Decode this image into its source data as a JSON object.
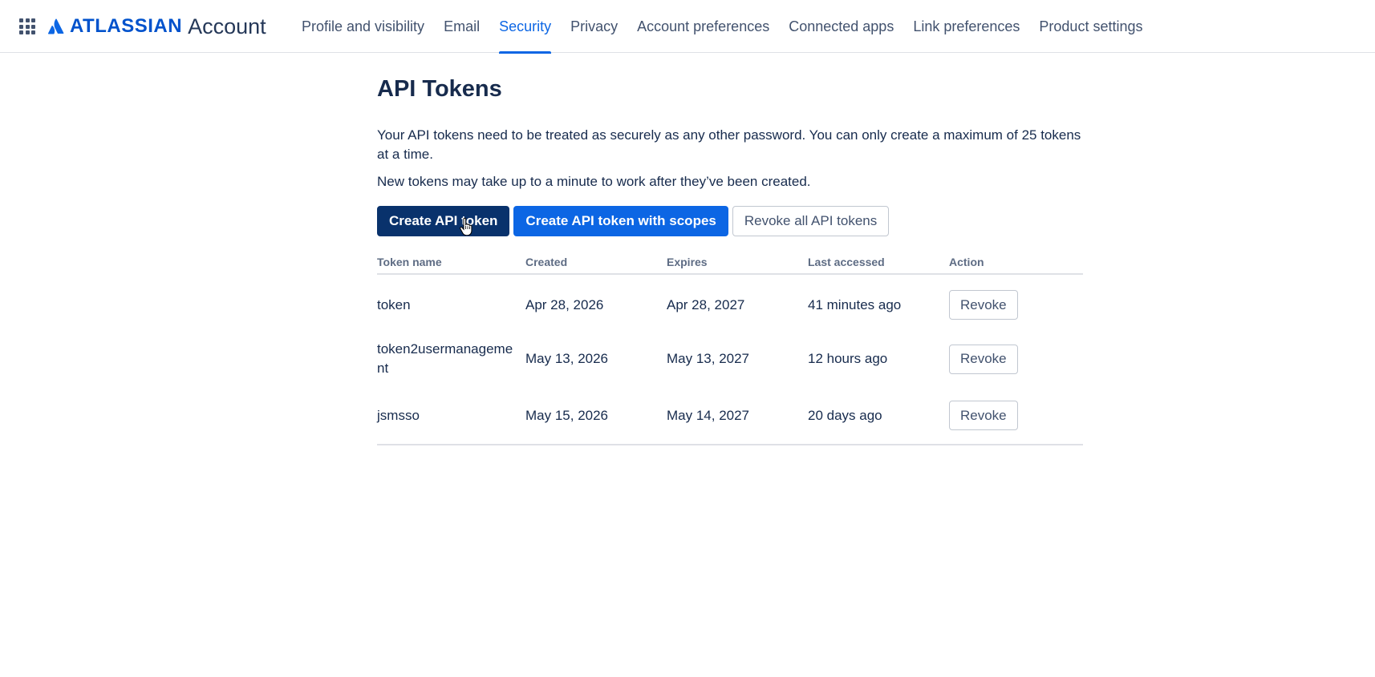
{
  "header": {
    "brand": "ATLASSIAN",
    "product": "Account",
    "nav": [
      {
        "label": "Profile and visibility",
        "active": false
      },
      {
        "label": "Email",
        "active": false
      },
      {
        "label": "Security",
        "active": true
      },
      {
        "label": "Privacy",
        "active": false
      },
      {
        "label": "Account preferences",
        "active": false
      },
      {
        "label": "Connected apps",
        "active": false
      },
      {
        "label": "Link preferences",
        "active": false
      },
      {
        "label": "Product settings",
        "active": false
      }
    ]
  },
  "main": {
    "title": "API Tokens",
    "description_1": "Your API tokens need to be treated as securely as any other password. You can only create a maximum of 25 tokens at a time.",
    "description_2": "New tokens may take up to a minute to work after they’ve been created.",
    "buttons": {
      "create": "Create API token",
      "create_scoped": "Create API token with scopes",
      "revoke_all": "Revoke all API tokens"
    },
    "table": {
      "headers": [
        "Token name",
        "Created",
        "Expires",
        "Last accessed",
        "Action"
      ],
      "rows": [
        {
          "name": "token",
          "created": "Apr 28, 2026",
          "expires": "Apr 28, 2027",
          "last_accessed": "41 minutes ago",
          "action": "Revoke"
        },
        {
          "name": "token2usermanagement",
          "created": "May 13, 2026",
          "expires": "May 13, 2027",
          "last_accessed": "12 hours ago",
          "action": "Revoke"
        },
        {
          "name": "jsmsso",
          "created": "May 15, 2026",
          "expires": "May 14, 2027",
          "last_accessed": "20 days ago",
          "action": "Revoke"
        }
      ]
    }
  },
  "colors": {
    "brand_blue": "#0052cc",
    "active_blue": "#0c66e4",
    "dark_button": "#09326c",
    "text": "#172b4d",
    "muted": "#42526e"
  },
  "icons": {
    "app_switcher": "app-switcher-grid-icon",
    "logo": "atlassian-logo-icon",
    "cursor": "hand-pointer-cursor"
  }
}
